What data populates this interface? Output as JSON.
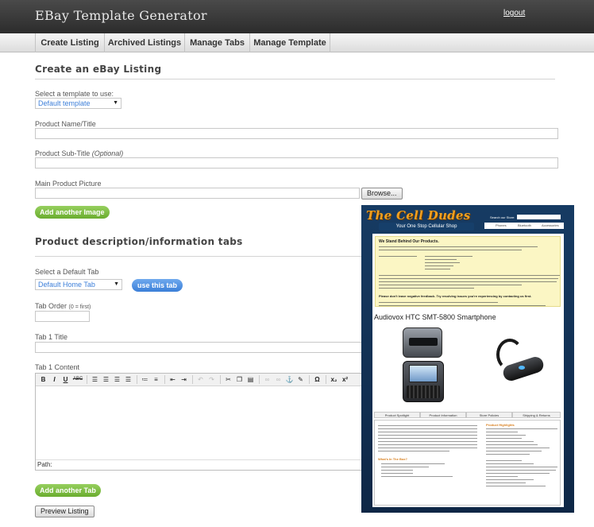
{
  "app": {
    "title": "EBay Template Generator",
    "logout": "logout"
  },
  "nav": {
    "tabs": [
      {
        "label": "Create Listing"
      },
      {
        "label": "Archived Listings"
      },
      {
        "label": "Manage Tabs"
      },
      {
        "label": "Manage Template"
      }
    ]
  },
  "listing": {
    "heading": "Create an eBay Listing",
    "template_label": "Select a template to use:",
    "template_value": "Default template",
    "name_label": "Product Name/Title",
    "subtitle_label": "Product Sub-Title ",
    "subtitle_optional": "(Optional)",
    "picture_label": "Main Product Picture",
    "browse": "Browse...",
    "add_image": "Add another Image"
  },
  "tabs_section": {
    "heading": "Product description/information tabs",
    "default_tab_label": "Select a Default Tab",
    "default_tab_value": "Default Home Tab",
    "use_this_tab": "use this tab",
    "tab_order_label": "Tab Order ",
    "tab_order_hint": "(0 = first)",
    "tab1_title_label": "Tab 1 Title",
    "tab1_content_label": "Tab 1 Content",
    "path_label": "Path:",
    "add_tab": "Add another Tab",
    "preview": "Preview Listing"
  },
  "editor_tools": {
    "bold": "B",
    "italic": "I",
    "underline": "U",
    "strike": "ABC",
    "undo": "↶",
    "redo": "↷",
    "anchor": "⚓",
    "omega": "Ω",
    "subscript": "x₂",
    "superscript": "x²"
  },
  "preview_panel": {
    "logo": "The Cell Dudes",
    "tagline": "Your One Stop Cellular Shop",
    "search_label": "Search our Store:",
    "nav": [
      "Phones",
      "Bluetooth",
      "Accessories"
    ],
    "notice_title": "We Stand Behind Our Products.",
    "notice_big": "Please don't leave negative feedback. Try resolving issues you're experiencing by contacting us first.",
    "product_title": "Audiovox HTC SMT-5800 Smartphone",
    "tabs": [
      "Product Spotlight",
      "Product Information",
      "Store Policies",
      "Shipping & Returns"
    ],
    "highlights_title": "Product Highlights",
    "box_title": "What's In The Box?"
  },
  "colors": {
    "topbar": "#2c2c2c",
    "green_button": "#6aad2e",
    "blue_button": "#3b7fd8",
    "select_text": "#3d7fd9",
    "preview_bg": "#163b63",
    "logo": "#f0a020"
  }
}
